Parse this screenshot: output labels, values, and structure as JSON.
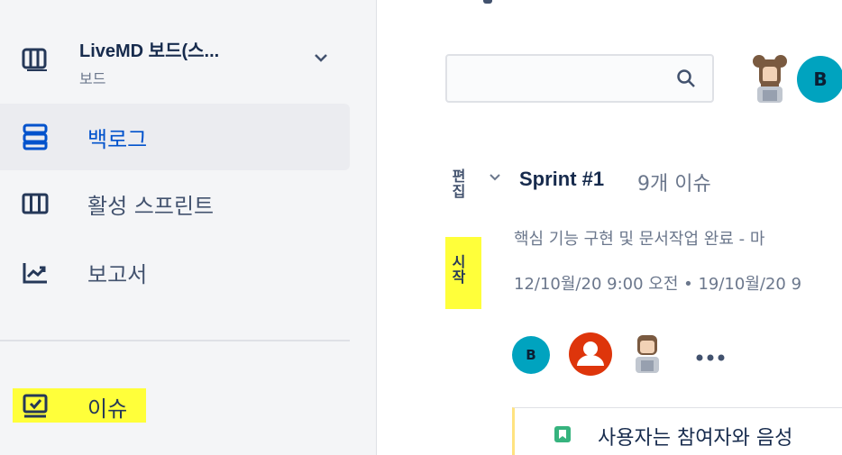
{
  "sidebar": {
    "board_title": "LiveMD 보드(스...",
    "board_subtitle": "보드",
    "items": [
      {
        "label": "백로그",
        "icon": "backlog-icon",
        "active": true
      },
      {
        "label": "활성 스프린트",
        "icon": "board-columns-icon",
        "active": false
      },
      {
        "label": "보고서",
        "icon": "reports-chart-icon",
        "active": false
      },
      {
        "label": "이슈",
        "icon": "issues-icon",
        "active": false
      }
    ]
  },
  "main": {
    "search": {
      "placeholder": "",
      "value": ""
    },
    "assignee_filter": {
      "initial": "B"
    },
    "side_labels": {
      "edit": "편집",
      "start": "시작"
    },
    "sprint": {
      "name": "Sprint #1",
      "issue_count": "9개 이슈",
      "goal": "핵심 기능 구현 및 문서작업 완료 - 마",
      "dates": "12/10월/20 9:00 오전 • 19/10월/20 9",
      "member_initial": "B"
    },
    "issue": {
      "summary": "사용자는 참여자와 음성"
    }
  },
  "colors": {
    "accent": "#0052cc",
    "avatar_teal": "#00a3bf",
    "avatar_red": "#de350b",
    "highlight": "#ffff3a",
    "story": "#36b37e"
  }
}
